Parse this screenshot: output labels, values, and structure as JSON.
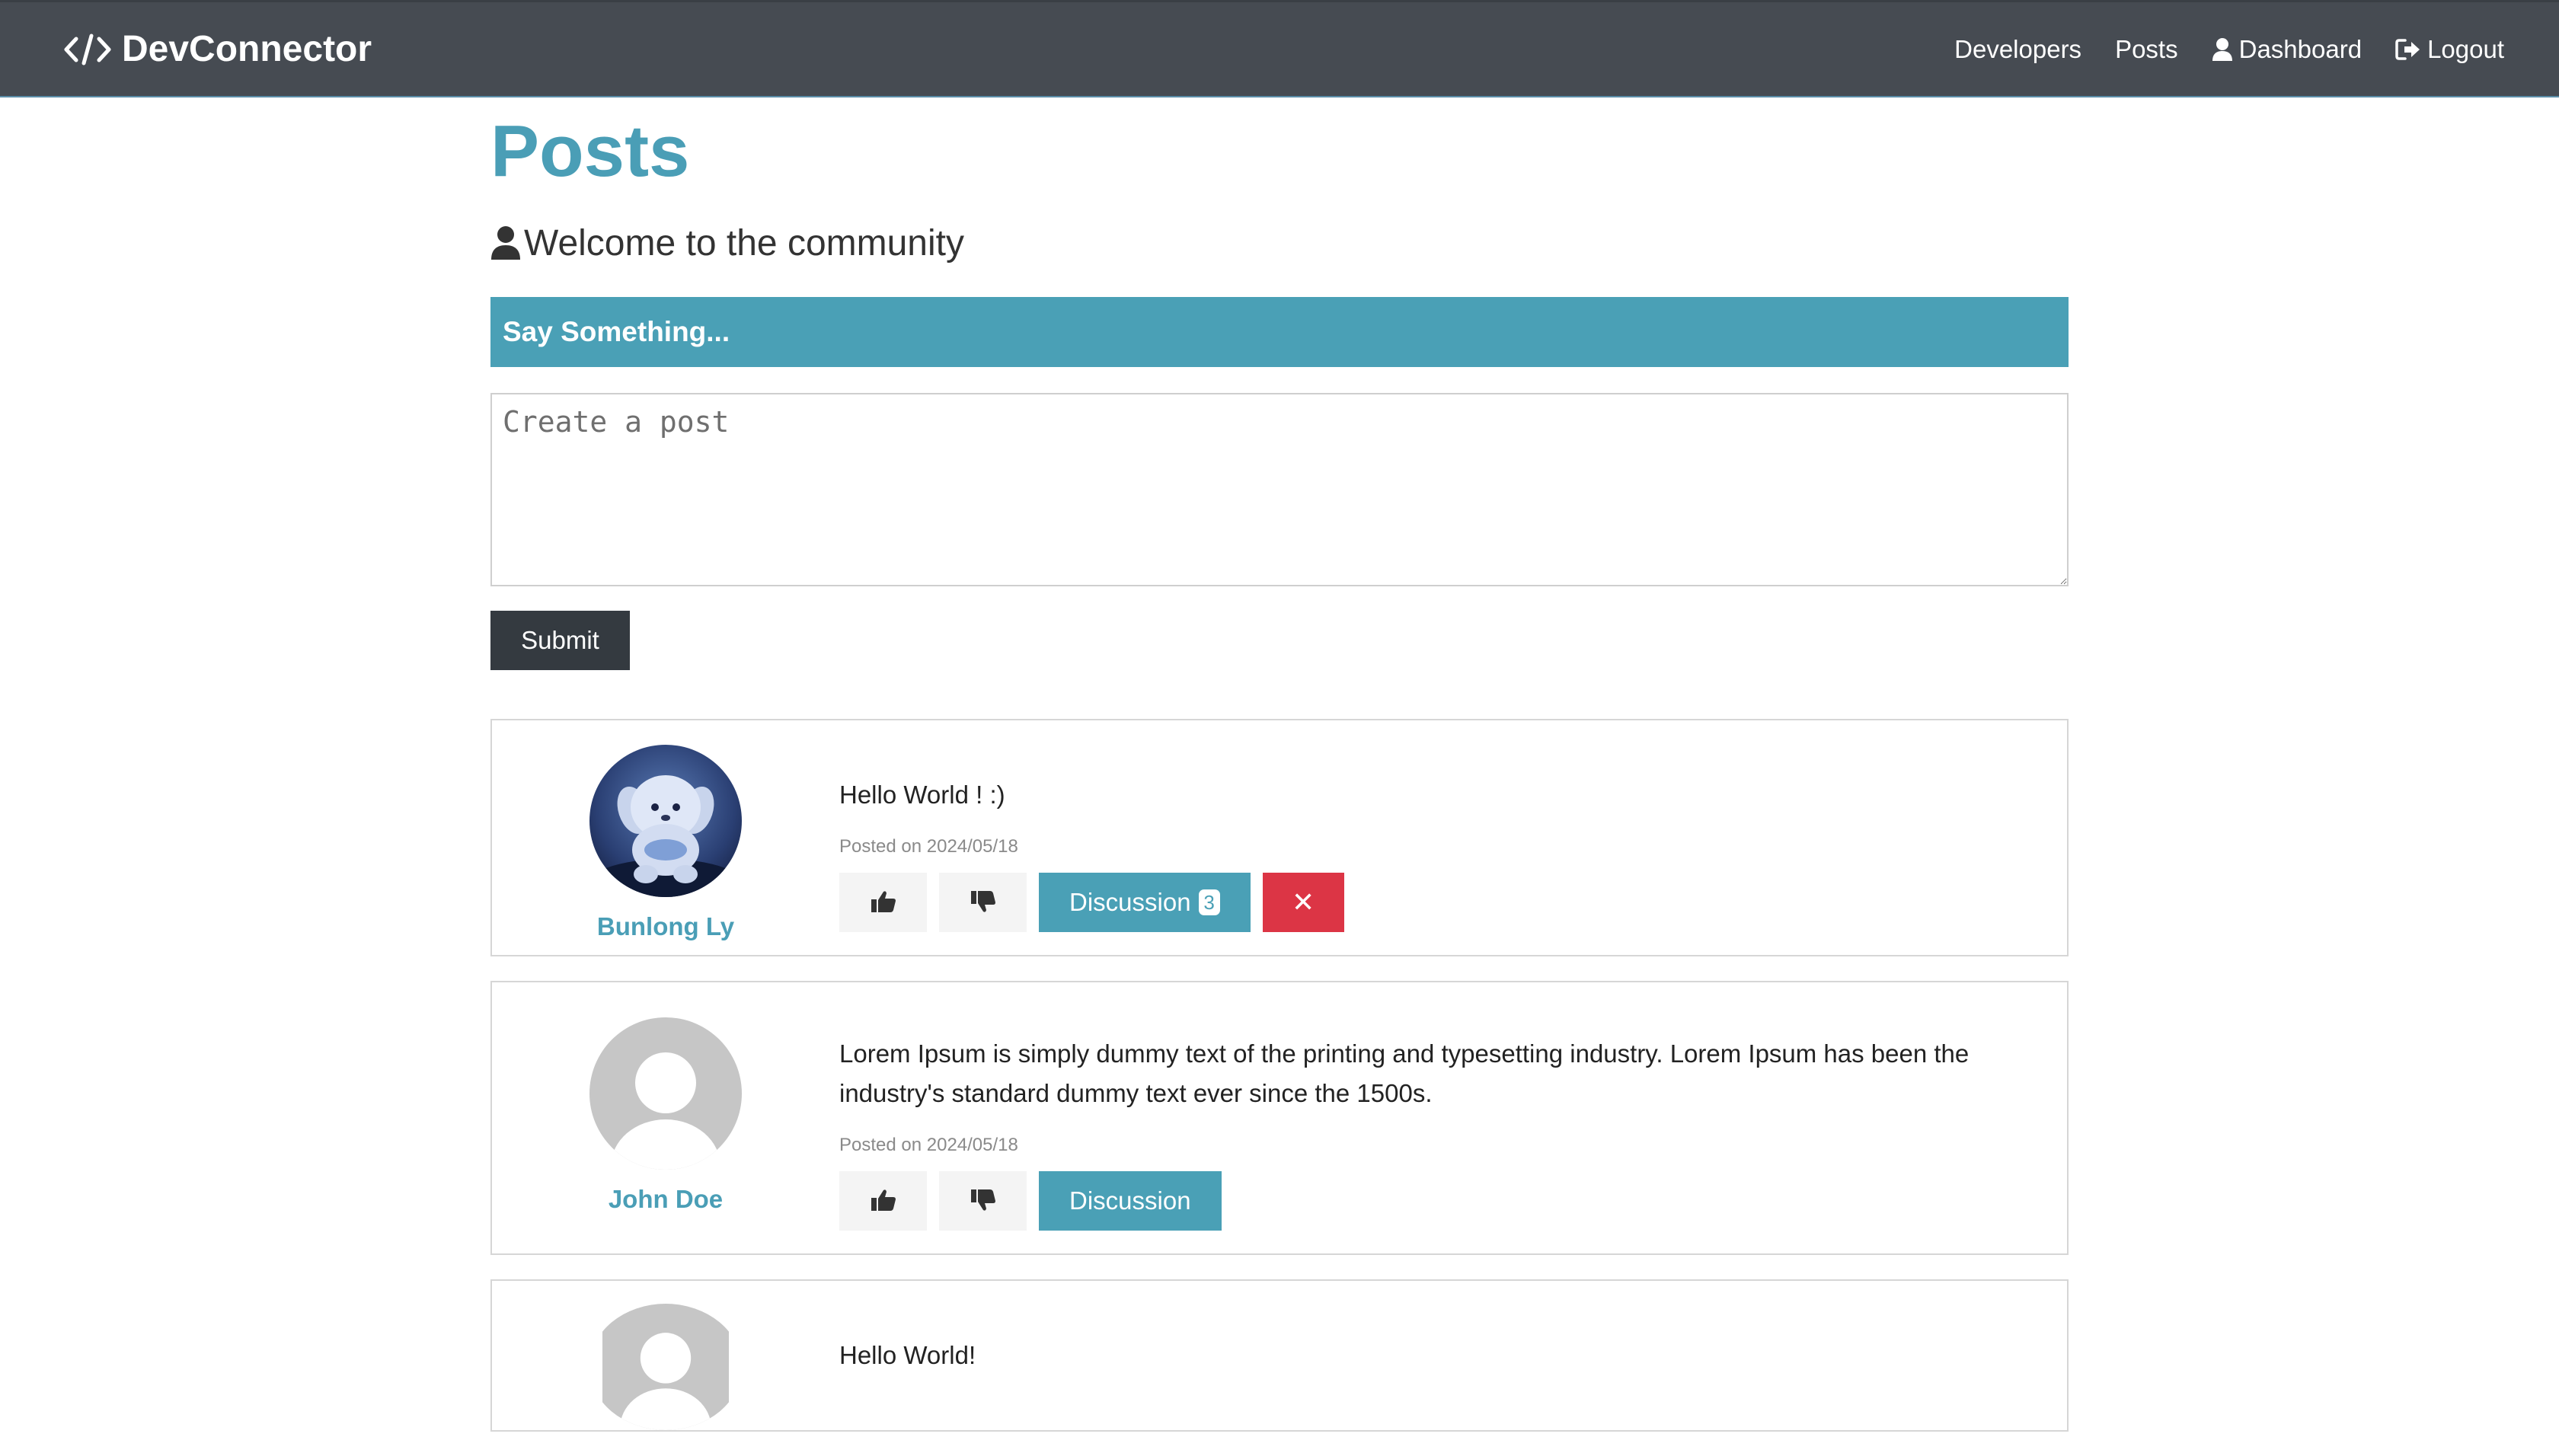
{
  "navbar": {
    "brand": "DevConnector",
    "links": [
      {
        "label": "Developers",
        "icon": ""
      },
      {
        "label": "Posts",
        "icon": ""
      },
      {
        "label": "Dashboard",
        "icon": "user-icon"
      },
      {
        "label": "Logout",
        "icon": "sign-out-icon"
      }
    ]
  },
  "page": {
    "title": "Posts",
    "lead": "Welcome to the community"
  },
  "form": {
    "header": "Say Something...",
    "placeholder": "Create a post",
    "submit_label": "Submit"
  },
  "posts": [
    {
      "author": "Bunlong Ly",
      "avatar": "photo",
      "text": "Hello World ! :)",
      "date": "Posted on 2024/05/18",
      "discussion_label": "Discussion",
      "comment_count": "3",
      "can_delete": true,
      "delete_label": "✕"
    },
    {
      "author": "John Doe",
      "avatar": "default",
      "text": "Lorem Ipsum is simply dummy text of the printing and typesetting industry. Lorem Ipsum has been the industry's standard dummy text ever since the 1500s.",
      "date": "Posted on 2024/05/18",
      "discussion_label": "Discussion"
    },
    {
      "author": "",
      "avatar": "default",
      "text": "Hello World!",
      "date": "",
      "discussion_label": ""
    }
  ],
  "colors": {
    "navbar": "#464b52",
    "primary": "#4aa0b6",
    "dark": "#343a40",
    "danger": "#dc3545"
  }
}
